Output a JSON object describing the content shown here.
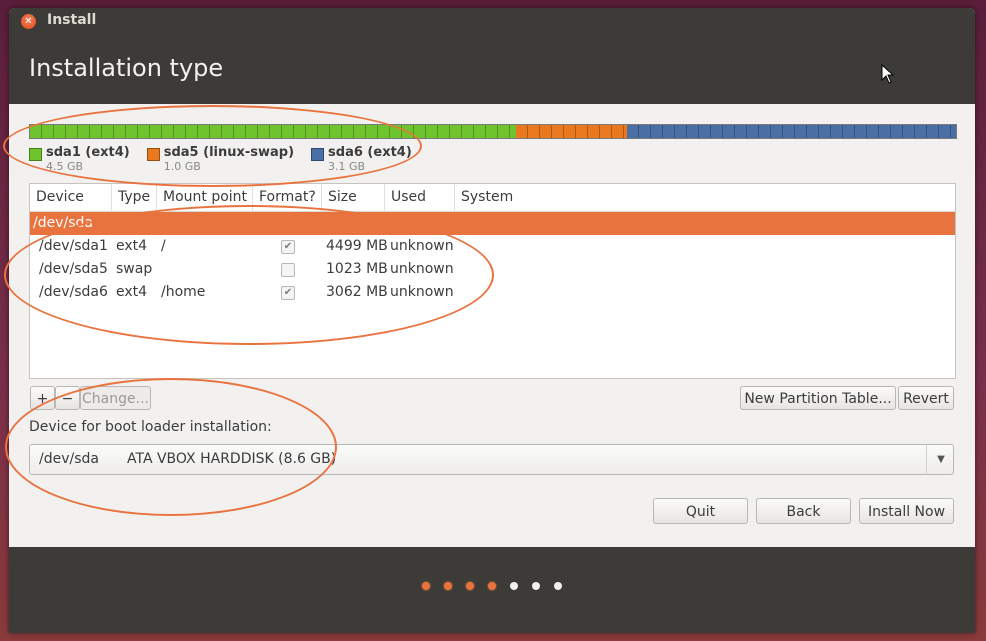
{
  "window": {
    "title": "Install",
    "page_title": "Installation type"
  },
  "partition_bar": [
    {
      "name": "sda1 (ext4)",
      "size": "4.5 GB",
      "color": "#6fc32d",
      "fraction": 0.525
    },
    {
      "name": "sda5 (linux-swap)",
      "size": "1.0 GB",
      "color": "#e9781e",
      "fraction": 0.12
    },
    {
      "name": "sda6 (ext4)",
      "size": "3.1 GB",
      "color": "#4a6fa5",
      "fraction": 0.355
    }
  ],
  "table": {
    "headers": [
      "Device",
      "Type",
      "Mount point",
      "Format?",
      "Size",
      "Used",
      "System"
    ],
    "group": "/dev/sda",
    "rows": [
      {
        "device": "/dev/sda1",
        "type": "ext4",
        "mount": "/",
        "format": true,
        "size": "4499 MB",
        "used": "unknown"
      },
      {
        "device": "/dev/sda5",
        "type": "swap",
        "mount": "",
        "format": false,
        "size": "1023 MB",
        "used": "unknown"
      },
      {
        "device": "/dev/sda6",
        "type": "ext4",
        "mount": "/home",
        "format": true,
        "size": "3062 MB",
        "used": "unknown"
      }
    ]
  },
  "partition_buttons": {
    "add": "+",
    "remove": "−",
    "change": "Change..."
  },
  "table_buttons": {
    "new_table": "New Partition Table...",
    "revert": "Revert"
  },
  "boot_loader": {
    "label": "Device for boot loader installation:",
    "device": "/dev/sda",
    "description": "ATA VBOX HARDDISK (8.6 GB)"
  },
  "actions": {
    "quit": "Quit",
    "back": "Back",
    "install": "Install Now"
  },
  "progress": {
    "steps_total": 7,
    "steps_done": 4
  },
  "icons": {
    "close": "close-icon",
    "cursor": "mouse-pointer-icon",
    "dropdown": "chevron-down-icon"
  },
  "colors": {
    "accent": "#e9733f",
    "titlebar": "#3c3b37",
    "background": "#f2f1f0"
  }
}
